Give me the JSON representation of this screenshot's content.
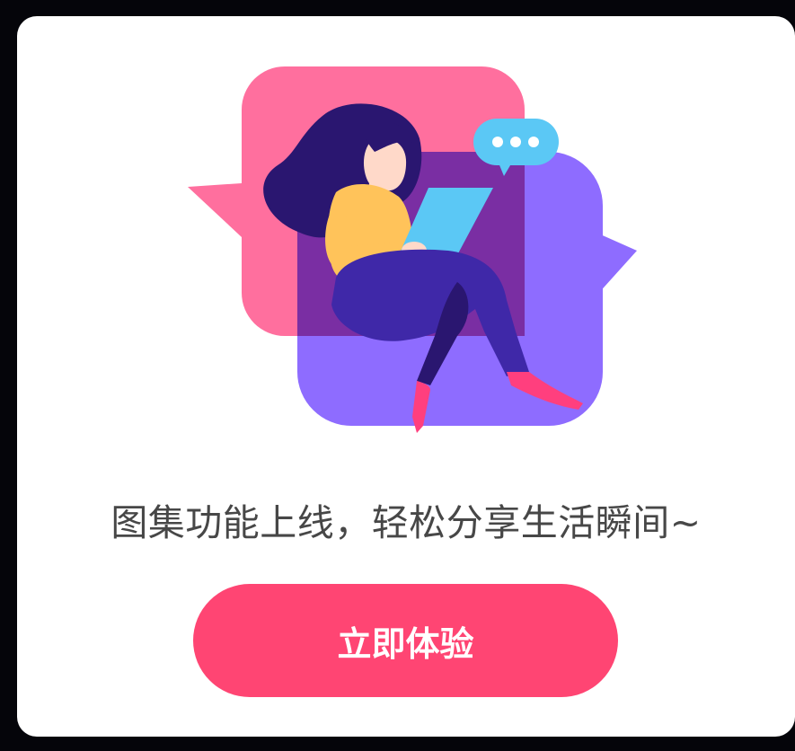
{
  "dialog": {
    "message": "图集功能上线，轻松分享生活瞬间~",
    "cta_label": "立即体验"
  },
  "illustration": {
    "description_icon": "woman-reading-tablet-illustration",
    "colors": {
      "pink_bubble": "#ff6f9e",
      "purple_bubble": "#8e6cff",
      "overlap": "#7a2ea3",
      "hair": "#2a1670",
      "sweater": "#ffc35a",
      "pants": "#3f28a8",
      "tablet": "#5bc8f5",
      "chat_bubble": "#5bc8f5",
      "shoes": "#ff3f7e",
      "skin": "#ffd9c9"
    }
  },
  "colors": {
    "button_bg": "#ff4573",
    "text": "#474747",
    "card_bg": "#ffffff",
    "backdrop": "#05050a"
  }
}
